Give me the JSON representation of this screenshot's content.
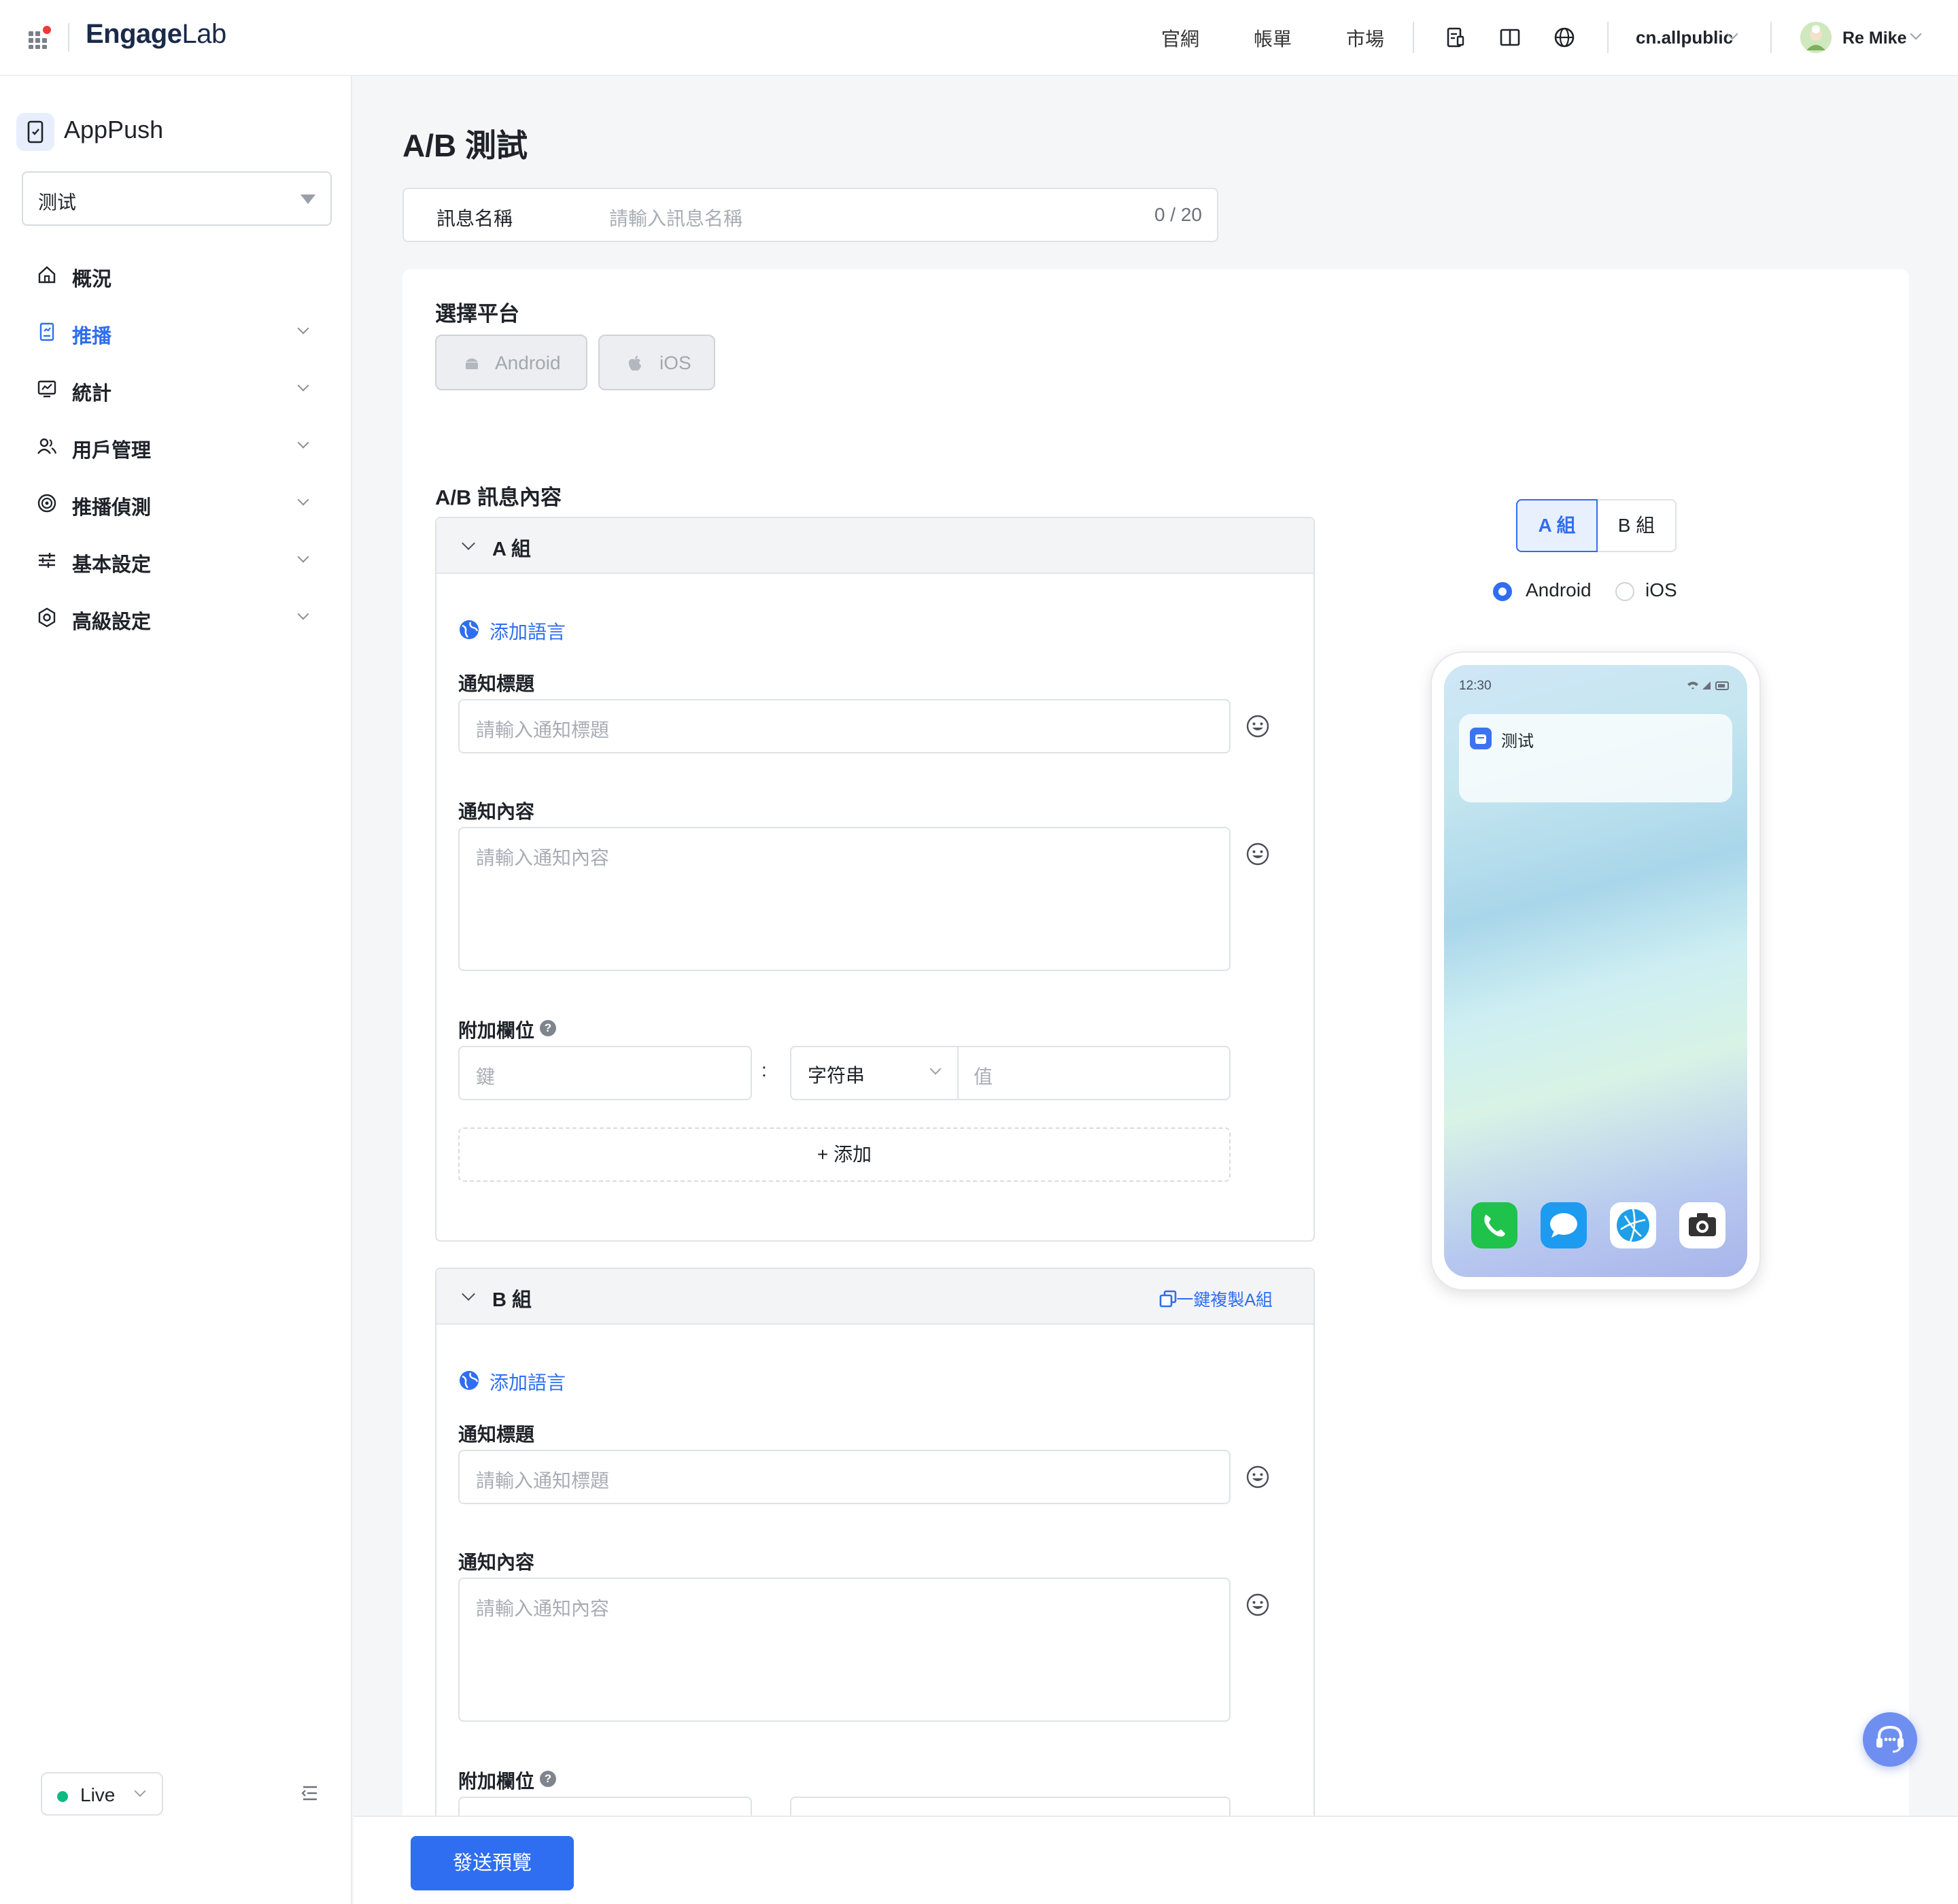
{
  "header": {
    "logo_main": "Engage",
    "logo_lab": "Lab",
    "nav": [
      "官網",
      "帳單",
      "市場"
    ],
    "env_name": "cn.allpublic",
    "user_name": "Re Mike"
  },
  "sidebar": {
    "app_title": "AppPush",
    "app_select": "测试",
    "menu": [
      {
        "label": "概況",
        "icon": "home-icon"
      },
      {
        "label": "推播",
        "icon": "push-icon"
      },
      {
        "label": "統計",
        "icon": "stats-icon"
      },
      {
        "label": "用戶管理",
        "icon": "users-icon"
      },
      {
        "label": "推播偵測",
        "icon": "detect-icon"
      },
      {
        "label": "基本設定",
        "icon": "sliders-icon"
      },
      {
        "label": "高級設定",
        "icon": "settings-icon"
      }
    ],
    "env": "Live"
  },
  "main": {
    "title": "A/B 測試",
    "name_field": {
      "label": "訊息名稱",
      "placeholder": "請輸入訊息名稱",
      "count": "0 / 20"
    },
    "platform": {
      "title": "選擇平台",
      "android": "Android",
      "ios": "iOS"
    },
    "ab": {
      "title": "A/B 訊息內容",
      "groups": [
        {
          "title": "A 組",
          "add_lang": "添加語言",
          "title_label": "通知標題",
          "title_ph": "請輸入通知標題",
          "content_label": "通知內容",
          "content_ph": "請輸入通知內容",
          "extra_label": "附加欄位",
          "key_ph": "鍵",
          "type": "字符串",
          "value_ph": "值",
          "add": "+ 添加"
        },
        {
          "title": "B 組",
          "copy": "一鍵複製A組",
          "add_lang": "添加語言",
          "title_label": "通知標題",
          "title_ph": "請輸入通知標題",
          "content_label": "通知內容",
          "content_ph": "請輸入通知內容",
          "extra_label": "附加欄位"
        }
      ]
    },
    "preview": {
      "tabs": [
        "A 組",
        "B 組"
      ],
      "active_tab": "A 組",
      "radios": [
        "Android",
        "iOS"
      ],
      "selected_radio": "Android",
      "phone_time": "12:30",
      "notif_app": "测试"
    }
  },
  "footer": {
    "send": "發送預覽"
  },
  "colors": {
    "primary": "#2f6ef0",
    "live": "#10b981"
  }
}
